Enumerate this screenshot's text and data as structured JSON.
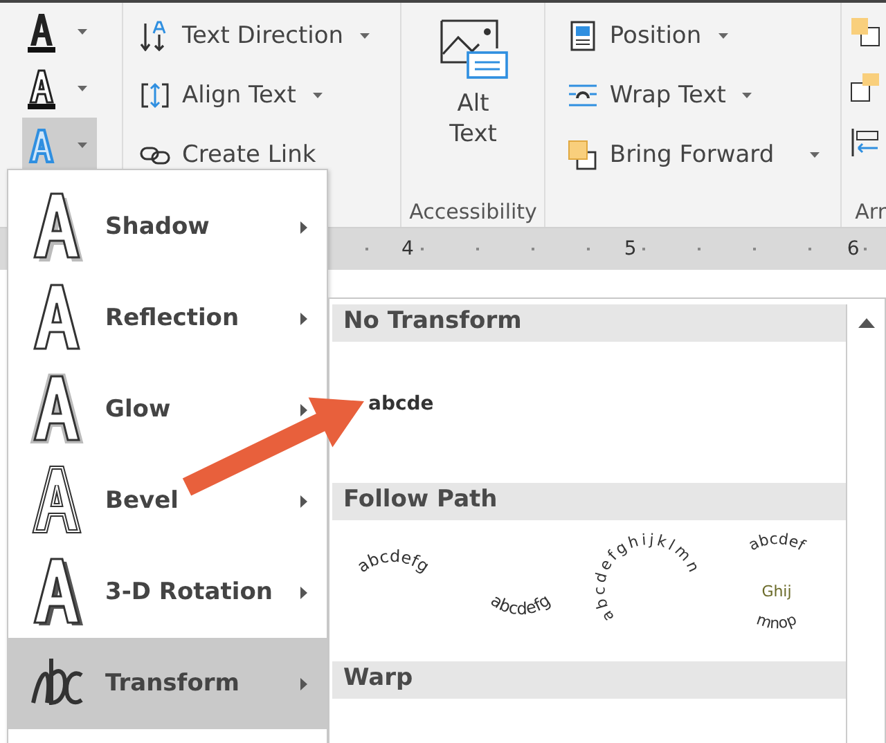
{
  "ribbon": {
    "effect_buttons": [
      {
        "kind": "filled",
        "selected": false
      },
      {
        "kind": "outlined",
        "selected": false
      },
      {
        "kind": "effects",
        "selected": true
      }
    ],
    "text_commands": [
      {
        "kind": "direction",
        "label": "Text Direction",
        "dropdown": true
      },
      {
        "kind": "align",
        "label": "Align Text",
        "dropdown": true
      },
      {
        "kind": "link",
        "label": "Create Link",
        "dropdown": false
      }
    ],
    "accessibility": {
      "button": "Alt Text",
      "group_label": "Accessibility"
    },
    "arrange_commands": [
      {
        "kind": "position",
        "label": "Position",
        "dropdown": true
      },
      {
        "kind": "wrap",
        "label": "Wrap Text",
        "dropdown": true
      },
      {
        "kind": "forward",
        "label": "Bring Forward",
        "dropdown": true
      }
    ],
    "arrange_label": "Arr"
  },
  "ruler": {
    "numbers": [
      "4",
      "5",
      "6"
    ]
  },
  "menu": {
    "items": [
      {
        "kind": "shadow",
        "label": "Shadow",
        "selected": false
      },
      {
        "kind": "reflection",
        "label": "Reflection",
        "selected": false
      },
      {
        "kind": "glow",
        "label": "Glow",
        "selected": false
      },
      {
        "kind": "bevel",
        "label": "Bevel",
        "selected": false
      },
      {
        "kind": "rotation",
        "label": "3-D Rotation",
        "selected": false
      },
      {
        "kind": "transform",
        "label": "Transform",
        "selected": true
      }
    ]
  },
  "submenu": {
    "sections": [
      {
        "title": "No Transform",
        "items": [
          {
            "kind": "plain",
            "text": "abcde"
          }
        ]
      },
      {
        "title": "Follow Path",
        "items": [
          {
            "kind": "arch-up",
            "text": "abcdefg"
          },
          {
            "kind": "arch-down",
            "text": "abcdefg"
          },
          {
            "kind": "circle",
            "text": "abcdefghijklmn"
          },
          {
            "kind": "button",
            "text": "abcdef",
            "middle": "Ghij",
            "bottom": "mnop"
          }
        ]
      },
      {
        "title": "Warp"
      }
    ]
  },
  "annotations": [
    {
      "kind": "arrow"
    }
  ]
}
